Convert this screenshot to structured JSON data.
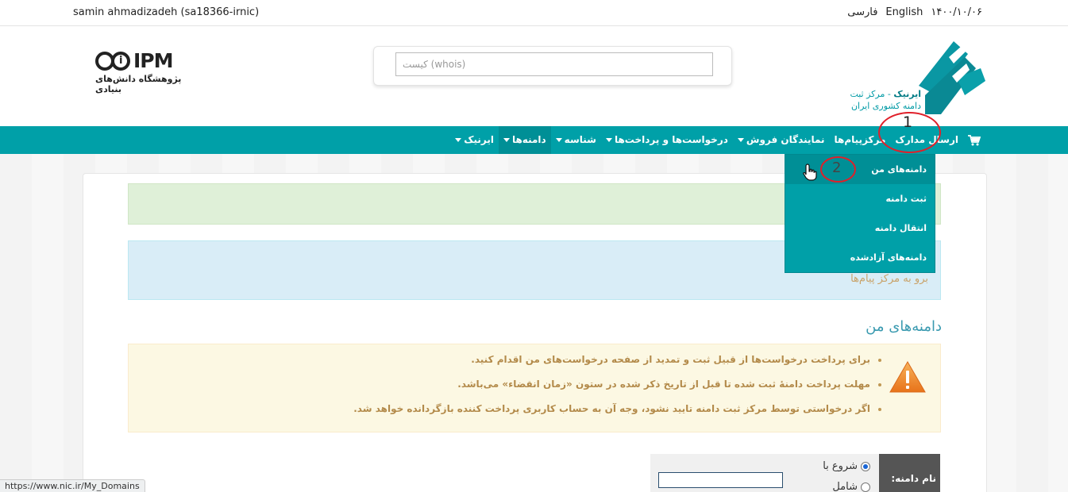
{
  "topbar": {
    "user": "samin ahmadizadeh (sa18366-irnic)",
    "lang_fa": "فارسی",
    "lang_en": "English",
    "date": "۱۴۰۰/۱۰/۰۶"
  },
  "header": {
    "ipm_logo_text": "IPM",
    "ipm_logo_sub": "پژوهشگاه دانش‌های بنیادی",
    "search_placeholder": "کیست (whois)",
    "irnic_line1_bold": "ایرنیک",
    "irnic_line1_rest": " - مرکز ثبت",
    "irnic_line2": "دامنه کشوری ایران"
  },
  "nav": {
    "items": [
      {
        "label": "ایرنیک",
        "dropdown": true
      },
      {
        "label": "دامنه‌ها",
        "dropdown": true
      },
      {
        "label": "شناسه",
        "dropdown": true
      },
      {
        "label": "درخواست‌ها و پرداخت‌ها",
        "dropdown": true
      },
      {
        "label": "نمایندگان فروش",
        "dropdown": true
      },
      {
        "label": "مرکزپیام‌ها",
        "dropdown": false
      },
      {
        "label": "ارسال مدارک",
        "dropdown": false
      }
    ],
    "cart_icon": "cart-icon"
  },
  "dropdown": {
    "items": [
      "دامنه‌های من",
      "ثبت دامنه",
      "انتقال دامنه",
      "دامنه‌های آزادشده"
    ]
  },
  "main": {
    "messages_link": "برو به مرکز پیام‌ها",
    "section_title": "دامنه‌های من",
    "warnings": [
      "برای پرداخت درخواست‌ها از قبیل ثبت و تمدید از صفحه درخواست‌های من اقدام کنید.",
      "مهلت پرداخت دامنهٔ ثبت شده تا قبل از تاریخ ذکر شده در ستون «زمان انقضاء» می‌باشد.",
      "اگر درخواستی توسط مرکز ثبت دامنه تایید نشود، وجه آن به حساب کاربری پرداخت کننده بازگردانده خواهد شد."
    ],
    "filter": {
      "label": "نام دامنه:",
      "option1": "شروع با",
      "option2": "شامل"
    }
  },
  "annotations": {
    "num1": "1",
    "num2": "2"
  },
  "status_url": "https://www.nic.ir/My_Domains"
}
